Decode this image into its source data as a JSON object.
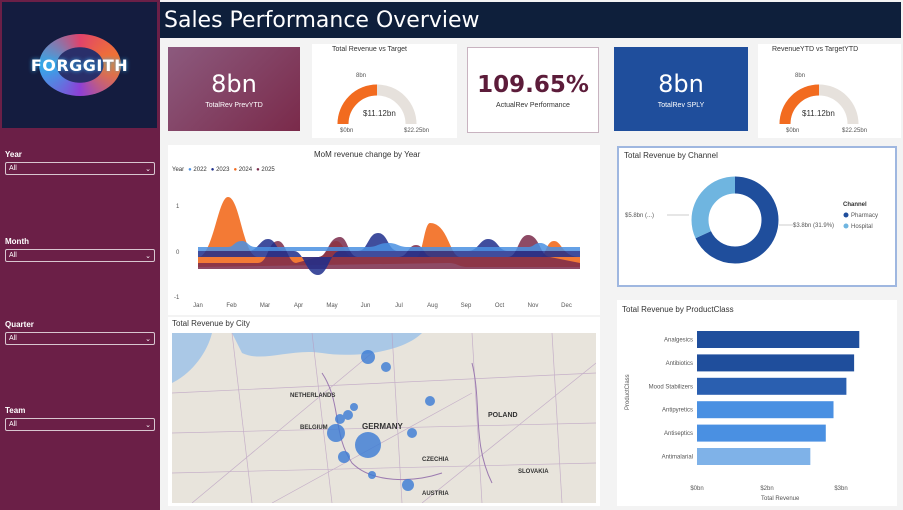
{
  "header": {
    "title": "Sales Performance Overview"
  },
  "logo": {
    "text": "FORGGITH"
  },
  "filters": [
    {
      "label": "Year",
      "value": "All"
    },
    {
      "label": "Month",
      "value": "All"
    },
    {
      "label": "Quarter",
      "value": "All"
    },
    {
      "label": "Team",
      "value": "All"
    }
  ],
  "kpis": {
    "rev_prevytd": {
      "value": "8bn",
      "label": "TotalRev PrevYTD"
    },
    "actual_perf": {
      "value": "109.65%",
      "label": "ActualRev Performance"
    },
    "rev_sply": {
      "value": "8bn",
      "label": "TotalRev SPLY"
    }
  },
  "gauges": {
    "rev_vs_target": {
      "title": "Total Revenue vs Target",
      "value": "8bn",
      "center": "$11.12bn",
      "min": "$0bn",
      "max": "$22.25bn",
      "fraction": 0.5
    },
    "revytd_vs_target": {
      "title": "RevenueYTD vs TargetYTD",
      "value": "8bn",
      "center": "$11.12bn",
      "min": "$0bn",
      "max": "$22.25bn",
      "fraction": 0.5
    }
  },
  "mom_chart": {
    "title": "MoM revenue change by Year",
    "legend_title": "Year",
    "legend": [
      {
        "name": "2022",
        "color": "#4a90e2"
      },
      {
        "name": "2023",
        "color": "#1e2e8c"
      },
      {
        "name": "2024",
        "color": "#f26b1f"
      },
      {
        "name": "2025",
        "color": "#7a2a4a"
      }
    ],
    "y_ticks": [
      "1",
      "0",
      "-1"
    ],
    "months": [
      "Jan",
      "Feb",
      "Mar",
      "Apr",
      "May",
      "Jun",
      "Jul",
      "Aug",
      "Sep",
      "Oct",
      "Nov",
      "Dec"
    ]
  },
  "map": {
    "title": "Total Revenue by City",
    "labels": [
      "NETHERLANDS",
      "GERMANY",
      "POLAND",
      "CZECHIA",
      "BELGIUM",
      "SLOVAKIA",
      "AUSTRIA"
    ]
  },
  "channel_chart": {
    "title": "Total Revenue by Channel",
    "legend_title": "Channel",
    "slices": [
      {
        "name": "Pharmacy",
        "value": 68,
        "color": "#1f4e9c",
        "label": "$5.8bn (...)"
      },
      {
        "name": "Hospital",
        "value": 32,
        "color": "#6fb5e0",
        "label": "$3.8bn (31.9%)"
      }
    ]
  },
  "product_chart": {
    "title": "Total Revenue by ProductClass",
    "xlabel": "Total Revenue",
    "ylabel": "ProductClass",
    "x_ticks": [
      "$0bn",
      "$2bn",
      "$3bn"
    ],
    "categories": [
      "Analgesics",
      "Antibiotics",
      "Mood Stabilizers",
      "Antipyretics",
      "Antiseptics",
      "Antimalarial"
    ],
    "values": [
      3.15,
      3.05,
      2.9,
      2.65,
      2.5,
      2.2
    ],
    "xmax": 3.3,
    "colors": [
      "#1f4e9c",
      "#1f4e9c",
      "#2a5fb0",
      "#4a90e2",
      "#4a90e2",
      "#7fb2e8"
    ]
  },
  "colors": {
    "sidebar": "#6b1f47",
    "header": "#0e1f3b",
    "gauge_fill": "#f26b1f",
    "gauge_track": "#e6e1dc"
  }
}
